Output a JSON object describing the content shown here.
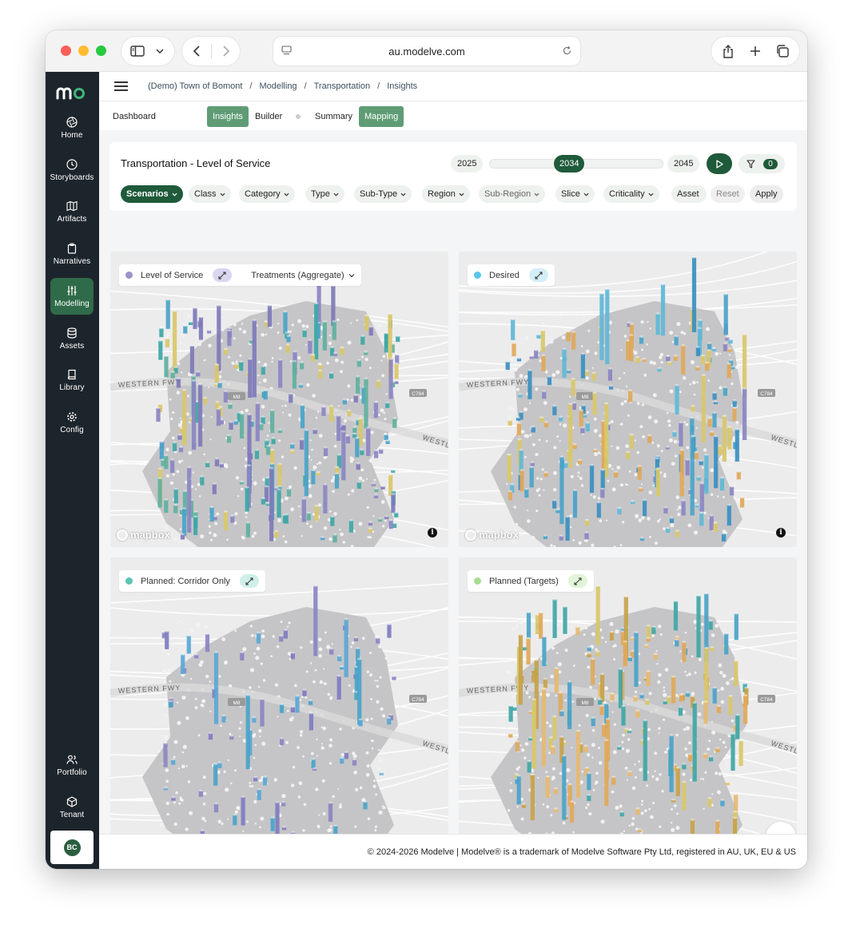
{
  "browser": {
    "url": "au.modelve.com",
    "icons": [
      "sidebar-icon",
      "chevron-down-icon",
      "back-icon",
      "forward-icon",
      "reader-icon",
      "reload-icon",
      "share-icon",
      "plus-icon",
      "tabs-icon"
    ]
  },
  "sidebar": {
    "logo": "mo",
    "items": [
      {
        "label": "Home",
        "icon": "aperture-icon"
      },
      {
        "label": "Storyboards",
        "icon": "clock-icon"
      },
      {
        "label": "Artifacts",
        "icon": "map-icon"
      },
      {
        "label": "Narratives",
        "icon": "clipboard-icon"
      },
      {
        "label": "Modelling",
        "icon": "sliders-icon",
        "active": true
      },
      {
        "label": "Assets",
        "icon": "database-icon"
      },
      {
        "label": "Library",
        "icon": "book-icon"
      },
      {
        "label": "Config",
        "icon": "gear-icon"
      }
    ],
    "bottom_items": [
      {
        "label": "Portfolio",
        "icon": "users-icon"
      },
      {
        "label": "Tenant",
        "icon": "box-icon"
      }
    ],
    "avatar": "BC"
  },
  "breadcrumb": [
    "(Demo) Town of Bomont",
    "Modelling",
    "Transportation",
    "Insights"
  ],
  "subtabs": {
    "dashboard": "Dashboard",
    "insights": "Insights",
    "builder": "Builder",
    "summary": "Summary",
    "mapping": "Mapping"
  },
  "panel": {
    "title": "Transportation - Level of Service",
    "year_start": "2025",
    "year_current": "2034",
    "year_end": "2045",
    "filter_count": "0"
  },
  "filters": {
    "scenarios": "Scenarios",
    "class": "Class",
    "category": "Category",
    "type": "Type",
    "subtype": "Sub-Type",
    "region": "Region",
    "subregion": "Sub-Region",
    "slice": "Slice",
    "criticality": "Criticality",
    "asset": "Asset",
    "reset": "Reset",
    "apply": "Apply"
  },
  "maps": [
    {
      "legend": "Level of Service",
      "color": "#9b93c9",
      "expand_bg": "#d9d6ef",
      "treatments": "Treatments (Aggregate)"
    },
    {
      "legend": "Desired",
      "color": "#5bc4ea",
      "expand_bg": "#d4eef8"
    },
    {
      "legend": "Planned: Corridor Only",
      "color": "#5ec4b3",
      "expand_bg": "#d0efe9"
    },
    {
      "legend": "Planned (Targets)",
      "color": "#a8dc8f",
      "expand_bg": "#e2f4d8"
    }
  ],
  "map_labels": {
    "western_fwy": "WESTERN FWY",
    "west": "WESTL",
    "shield_1": "M8",
    "shield_2": "C784",
    "mapbox": "mapbox",
    "info": "i"
  },
  "footer": "© 2024-2026 Modelve | Modelve® is a trademark of Modelve Software Pty Ltd, registered in AU, UK, EU & US"
}
